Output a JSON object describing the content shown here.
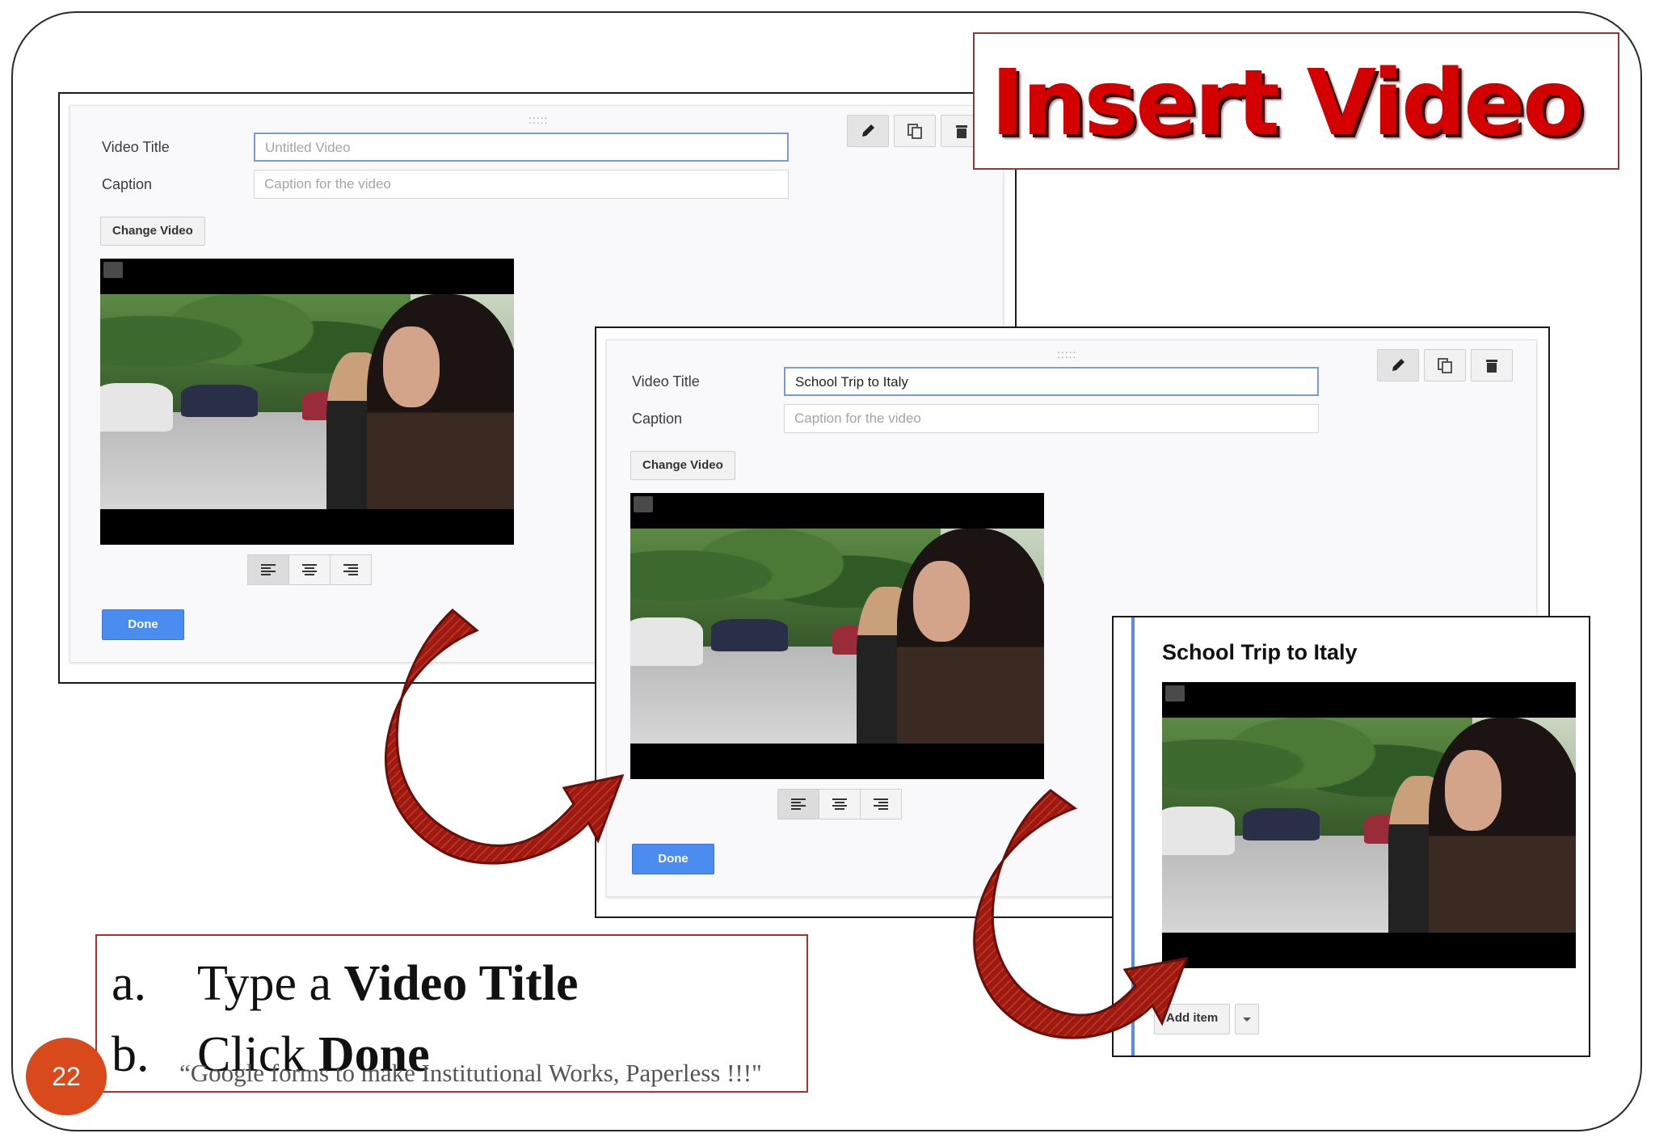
{
  "slide_title": "Insert Video",
  "page_number": "22",
  "footer": "“Google forms to make Institutional Works, Paperless !!!\"",
  "drag_handle": ":::::",
  "editor1": {
    "video_title_label": "Video Title",
    "video_title_placeholder": "Untitled Video",
    "caption_label": "Caption",
    "caption_placeholder": "Caption for the video",
    "change_video": "Change Video",
    "done": "Done"
  },
  "editor2": {
    "video_title_label": "Video Title",
    "video_title_value": "School Trip to Italy",
    "caption_label": "Caption",
    "caption_placeholder": "Caption for the video",
    "change_video": "Change Video",
    "done": "Done"
  },
  "preview": {
    "title": "School Trip to Italy",
    "add_item": "Add item"
  },
  "instructions": [
    {
      "marker": "a.",
      "text": "Type a ",
      "bold": "Video Title"
    },
    {
      "marker": "b.",
      "text": "Click ",
      "bold": "Done"
    }
  ],
  "colors": {
    "title_red": "#d40000",
    "done_blue": "#4a8cf0",
    "arrow_red": "#9e1a10",
    "badge_orange": "#d84a1b"
  },
  "icons": [
    "pencil-icon",
    "duplicate-icon",
    "trash-icon",
    "video-camera-icon",
    "align-left-icon",
    "align-center-icon",
    "align-right-icon",
    "dropdown-caret-icon"
  ]
}
